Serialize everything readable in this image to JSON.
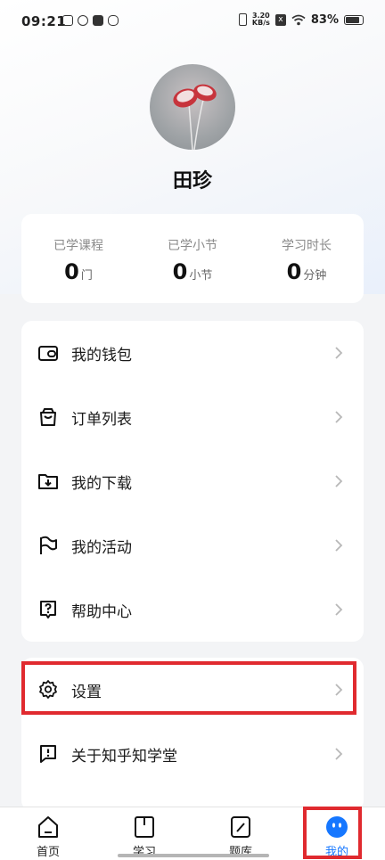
{
  "status_bar": {
    "time": "09:21",
    "net_speed_value": "3.20",
    "net_speed_unit": "KB/s",
    "sim_icon_text": "x",
    "battery": "83%",
    "battery_level": 0.83
  },
  "profile": {
    "name": "田珍",
    "avatar_icon": "flower-avatar"
  },
  "stats": [
    {
      "label": "已学课程",
      "value": "0",
      "unit": "门"
    },
    {
      "label": "已学小节",
      "value": "0",
      "unit": "小节"
    },
    {
      "label": "学习时长",
      "value": "0",
      "unit": "分钟"
    }
  ],
  "menu": [
    {
      "label": "我的钱包",
      "icon": "wallet-icon"
    },
    {
      "label": "订单列表",
      "icon": "shopping-bag-icon"
    },
    {
      "label": "我的下载",
      "icon": "download-folder-icon"
    },
    {
      "label": "我的活动",
      "icon": "flag-icon"
    },
    {
      "label": "帮助中心",
      "icon": "help-icon"
    }
  ],
  "menu2": [
    {
      "label": "设置",
      "icon": "gear-icon"
    },
    {
      "label": "关于知乎知学堂",
      "icon": "info-icon"
    }
  ],
  "nav": [
    {
      "label": "首页",
      "icon": "home-icon"
    },
    {
      "label": "学习",
      "icon": "book-icon"
    },
    {
      "label": "题库",
      "icon": "edit-icon"
    },
    {
      "label": "我的",
      "icon": "profile-face-icon",
      "active": true
    }
  ],
  "colors": {
    "accent": "#1677ff",
    "highlight": "#e02a2f",
    "background": "#f3f4f6"
  }
}
